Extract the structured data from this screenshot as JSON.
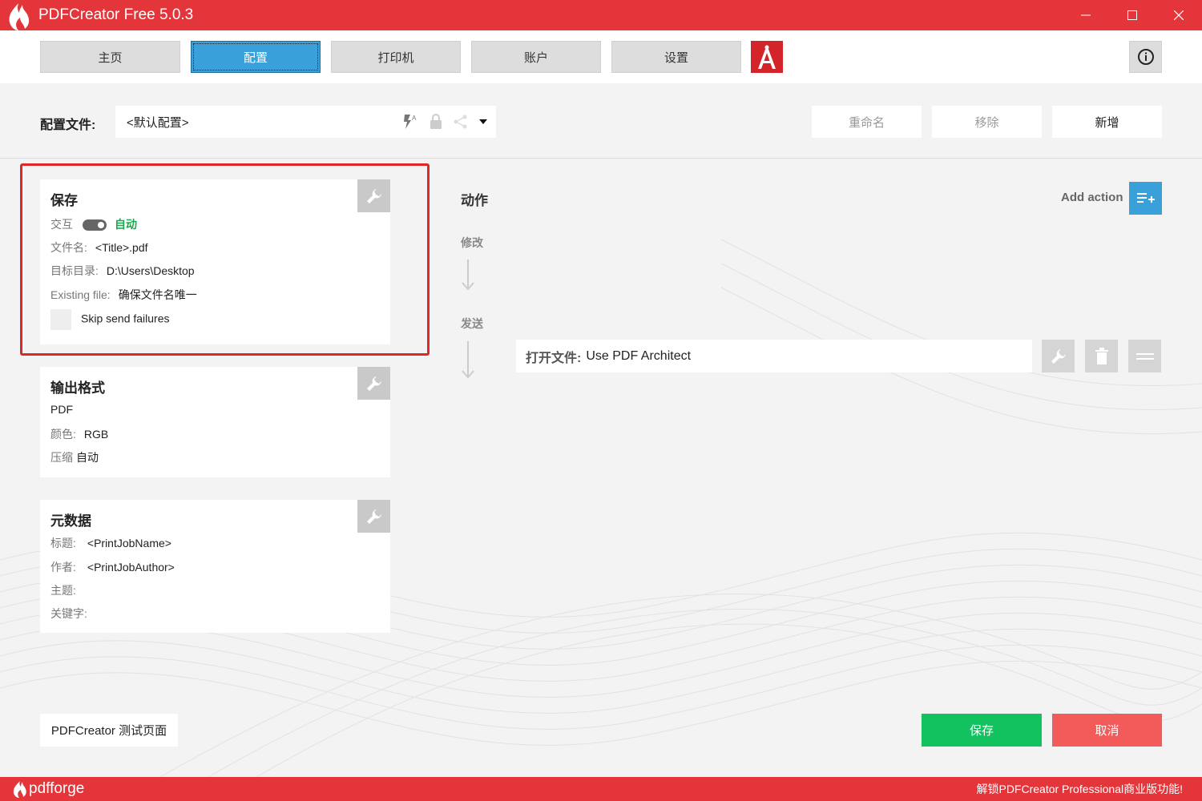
{
  "window": {
    "title": "PDFCreator Free 5.0.3"
  },
  "nav": {
    "items": [
      {
        "label": "主页"
      },
      {
        "label": "配置"
      },
      {
        "label": "打印机"
      },
      {
        "label": "账户"
      },
      {
        "label": "设置"
      }
    ],
    "active": "配置"
  },
  "profile": {
    "label": "配置文件:",
    "selected": "<默认配置>",
    "rename_label": "重命名",
    "remove_label": "移除",
    "add_label": "新增"
  },
  "save_card": {
    "title": "保存",
    "interactive_label": "交互",
    "auto_label": "自动",
    "filename_label": "文件名:",
    "filename_value": "<Title>.pdf",
    "target_label": "目标目录:",
    "target_value": "D:\\Users\\Desktop",
    "existing_label": "Existing file:",
    "existing_value": "确保文件名唯一",
    "skip_label": "Skip send failures"
  },
  "output_card": {
    "title": "输出格式",
    "format": "PDF",
    "color_label": "颜色:",
    "color_value": "RGB",
    "compress_label": "压缩",
    "compress_value": "自动"
  },
  "metadata_card": {
    "title": "元数据",
    "title_label": "标题:",
    "title_value": "<PrintJobName>",
    "author_label": "作者:",
    "author_value": "<PrintJobAuthor>",
    "subject_label": "主题:",
    "keywords_label": "关键字:"
  },
  "actions": {
    "title": "动作",
    "modify_label": "修改",
    "send_label": "发送",
    "add_action_label": "Add action",
    "item_label": "打开文件:",
    "item_value": "Use PDF Architect"
  },
  "bottom": {
    "testpage_label": "PDFCreator 测试页面",
    "save_label": "保存",
    "cancel_label": "取消"
  },
  "footer": {
    "brand": "pdfforge",
    "promo": "解锁PDFCreator Professional商业版功能!"
  },
  "colors": {
    "brand_red": "#e4353a",
    "accent_blue": "#3aa0d9",
    "save_green": "#12c25e",
    "cancel_red": "#f35b5b",
    "auto_green": "#1aa851"
  }
}
